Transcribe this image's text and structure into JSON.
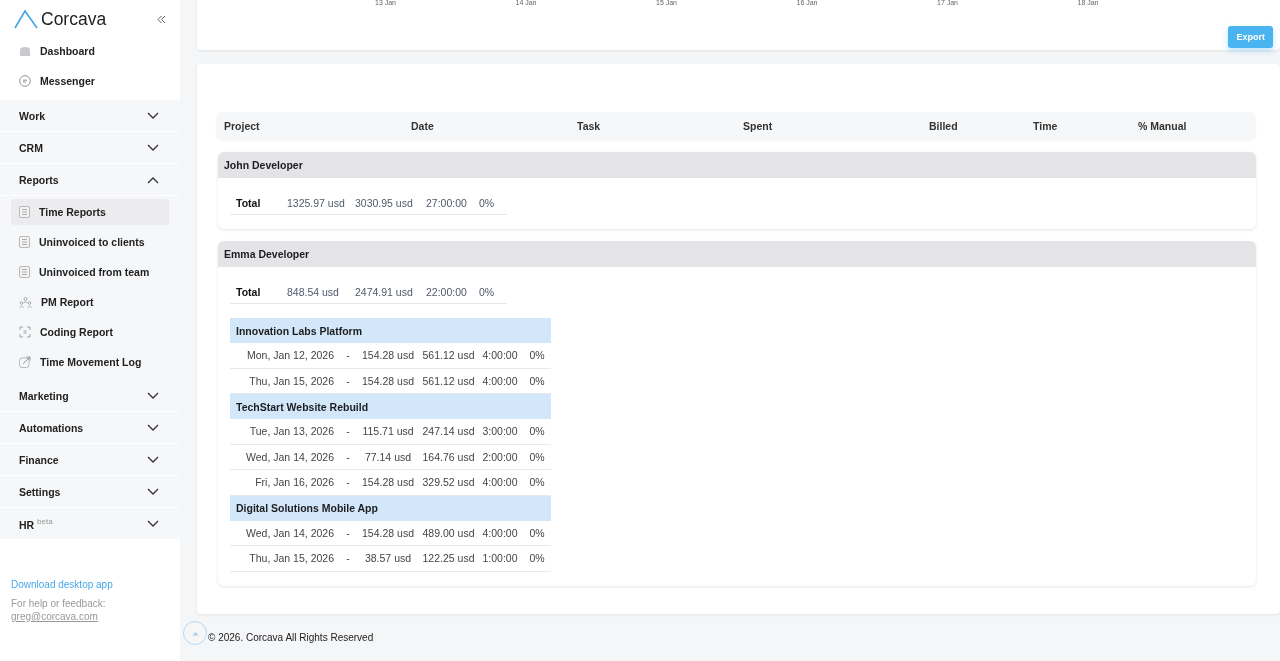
{
  "sidebar": {
    "brand": "Corcava",
    "top_items": [
      {
        "label": "Dashboard",
        "selected": false
      },
      {
        "label": "Messenger",
        "selected": false
      }
    ],
    "sections": [
      {
        "label": "Work",
        "expanded": false
      },
      {
        "label": "CRM",
        "expanded": false
      },
      {
        "label": "Reports",
        "expanded": true,
        "items": [
          {
            "label": "Time Reports",
            "selected": true
          },
          {
            "label": "Uninvoiced to clients",
            "selected": false
          },
          {
            "label": "Uninvoiced from team",
            "selected": false
          },
          {
            "label": "PM Report",
            "selected": false
          },
          {
            "label": "Coding Report",
            "selected": false
          },
          {
            "label": "Time Movement Log",
            "selected": false
          }
        ]
      },
      {
        "label": "Marketing",
        "expanded": false
      },
      {
        "label": "Automations",
        "expanded": false
      },
      {
        "label": "Finance",
        "expanded": false
      },
      {
        "label": "Settings",
        "expanded": false
      },
      {
        "label": "HR $^{beta}$",
        "expanded": false
      }
    ],
    "download_link": "Download desktop app",
    "help_text": "For help or feedback:",
    "help_email": "greg@corcava.com"
  },
  "chart": {
    "x_labels": [
      "13 Jan",
      "14 Jan",
      "15 Jan",
      "16 Jan",
      "17 Jan",
      "18 Jan"
    ]
  },
  "export_button": "Export",
  "table": {
    "columns": [
      "Project",
      "Date",
      "Task",
      "Spent",
      "Billed",
      "Time",
      "% Manual"
    ],
    "groups": [
      {
        "name": "John Developer",
        "total": {
          "label": "Total",
          "spent": "1325.97 usd",
          "billed": "3030.95 usd",
          "time": "27:00:00",
          "manual": "0%"
        }
      },
      {
        "name": "Emma Developer",
        "total": {
          "label": "Total",
          "spent": "848.54 usd",
          "billed": "2474.91 usd",
          "time": "22:00:00",
          "manual": "0%"
        },
        "projects": [
          {
            "name": "Innovation Labs Platform",
            "rows": [
              {
                "date": "Mon, Jan 12, 2026",
                "task": "-",
                "spent": "154.28 usd",
                "billed": "561.12 usd",
                "time": "4:00:00",
                "manual": "0%"
              },
              {
                "date": "Thu, Jan 15, 2026",
                "task": "-",
                "spent": "154.28 usd",
                "billed": "561.12 usd",
                "time": "4:00:00",
                "manual": "0%"
              }
            ]
          },
          {
            "name": "TechStart Website Rebuild",
            "rows": [
              {
                "date": "Tue, Jan 13, 2026",
                "task": "-",
                "spent": "115.71 usd",
                "billed": "247.14 usd",
                "time": "3:00:00",
                "manual": "0%"
              },
              {
                "date": "Wed, Jan 14, 2026",
                "task": "-",
                "spent": "77.14 usd",
                "billed": "164.76 usd",
                "time": "2:00:00",
                "manual": "0%"
              },
              {
                "date": "Fri, Jan 16, 2026",
                "task": "-",
                "spent": "154.28 usd",
                "billed": "329.52 usd",
                "time": "4:00:00",
                "manual": "0%"
              }
            ]
          },
          {
            "name": "Digital Solutions Mobile App",
            "rows": [
              {
                "date": "Wed, Jan 14, 2026",
                "task": "-",
                "spent": "154.28 usd",
                "billed": "489.00 usd",
                "time": "4:00:00",
                "manual": "0%"
              },
              {
                "date": "Thu, Jan 15, 2026",
                "task": "-",
                "spent": "38.57 usd",
                "billed": "122.25 usd",
                "time": "1:00:00",
                "manual": "0%"
              }
            ]
          }
        ]
      }
    ]
  },
  "footer": "© 2026. Corcava All Rights Reserved"
}
